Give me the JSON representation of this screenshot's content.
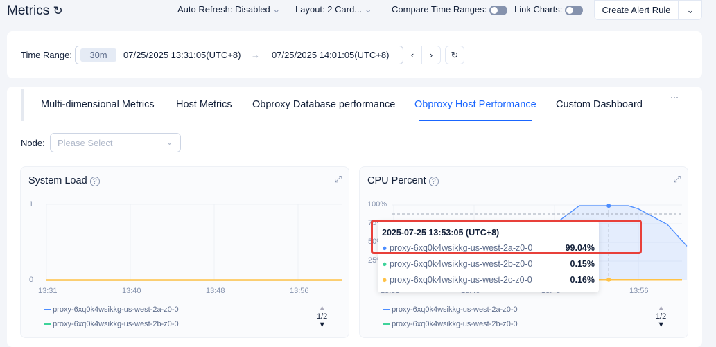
{
  "header": {
    "title": "Metrics",
    "auto_refresh_label": "Auto Refresh:",
    "auto_refresh_value": "Disabled",
    "layout_label": "Layout:",
    "layout_value": "2 Card...",
    "compare_label": "Compare Time Ranges:",
    "link_label": "Link Charts:",
    "create_alert": "Create Alert Rule"
  },
  "time_range": {
    "label": "Time Range:",
    "quick": "30m",
    "start": "07/25/2025 13:31:05(UTC+8)",
    "end": "07/25/2025 14:01:05(UTC+8)"
  },
  "tabs": [
    {
      "label": "Multi-dimensional Metrics"
    },
    {
      "label": "Host Metrics"
    },
    {
      "label": "Obproxy Database performance"
    },
    {
      "label": "Obproxy Host Performance",
      "active": true
    },
    {
      "label": "Custom Dashboard"
    }
  ],
  "more": "···",
  "node": {
    "label": "Node:",
    "placeholder": "Please Select"
  },
  "colors": {
    "accent": "#1a66ff",
    "series_a": "#4c8dff",
    "series_b": "#3ed39a",
    "series_c": "#ffc247",
    "highlight": "#e8403a"
  },
  "chart_data": [
    {
      "type": "line",
      "title": "System Load",
      "x_ticks": [
        "13:31",
        "13:40",
        "13:48",
        "13:56"
      ],
      "y_ticks": [
        "0",
        "1"
      ],
      "ylim": [
        0,
        1
      ],
      "series": [
        {
          "name": "proxy-6xq0k4wsikkg-us-west-2a-z0-0",
          "color": "#4c8dff"
        },
        {
          "name": "proxy-6xq0k4wsikkg-us-west-2b-z0-0",
          "color": "#3ed39a"
        }
      ],
      "legend_page": "1/2"
    },
    {
      "type": "area",
      "title": "CPU Percent",
      "x_ticks": [
        "13:31",
        "13:40",
        "13:48",
        "13:56"
      ],
      "y_ticks": [
        "100%",
        "75%",
        "50%",
        "25%"
      ],
      "ylim": [
        0,
        100
      ],
      "series": [
        {
          "name": "proxy-6xq0k4wsikkg-us-west-2a-z0-0",
          "color": "#4c8dff",
          "points": [
            [
              "13:44",
              0.2
            ],
            [
              "13:47",
              70
            ],
            [
              "13:50",
              99
            ],
            [
              "13:55",
              99
            ],
            [
              "13:56",
              95
            ],
            [
              "13:57",
              88
            ],
            [
              "13:59",
              74
            ],
            [
              "14:01",
              45
            ]
          ]
        },
        {
          "name": "proxy-6xq0k4wsikkg-us-west-2b-z0-0",
          "color": "#3ed39a",
          "points": [
            [
              "13:31",
              0.15
            ],
            [
              "14:01",
              0.15
            ]
          ]
        },
        {
          "name": "proxy-6xq0k4wsikkg-us-west-2c-z0-0",
          "color": "#ffc247",
          "points": [
            [
              "13:31",
              0.16
            ],
            [
              "14:01",
              0.16
            ]
          ]
        }
      ],
      "legend_page": "1/2",
      "tooltip": {
        "time": "2025-07-25 13:53:05 (UTC+8)",
        "rows": [
          {
            "name": "proxy-6xq0k4wsikkg-us-west-2a-z0-0",
            "value": "99.04%"
          },
          {
            "name": "proxy-6xq0k4wsikkg-us-west-2b-z0-0",
            "value": "0.15%"
          },
          {
            "name": "proxy-6xq0k4wsikkg-us-west-2c-z0-0",
            "value": "0.16%"
          }
        ]
      }
    }
  ]
}
